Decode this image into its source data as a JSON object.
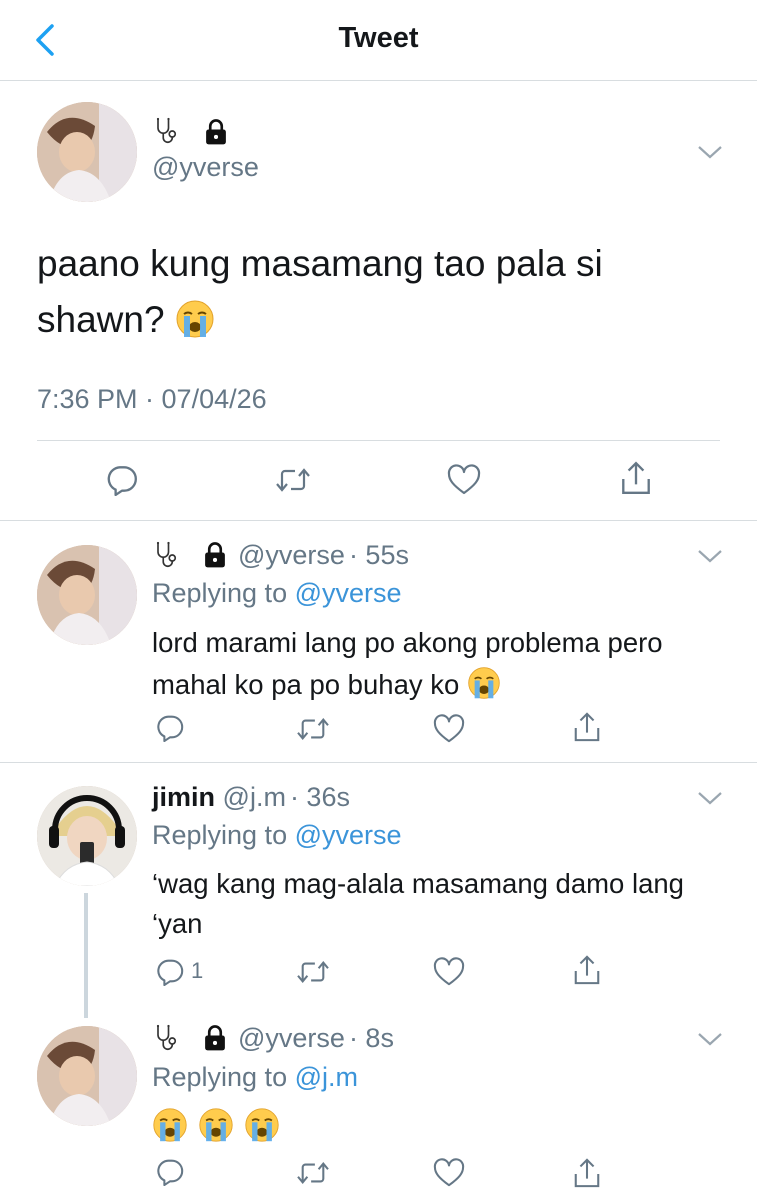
{
  "header": {
    "title": "Tweet",
    "back_icon": "back-chevron-icon"
  },
  "main_tweet": {
    "handle": "@yverse",
    "badges": [
      "stethoscope-icon",
      "lock-icon"
    ],
    "text": "paano kung masamang tao pala si shawn?",
    "emoji": "loudly-crying-face",
    "timestamp": "7:36 PM · 07/04/26"
  },
  "replies": [
    {
      "name": "",
      "handle": "@yverse",
      "time": "· 55s",
      "replying_prefix": "Replying to",
      "replying_to": "@yverse",
      "text": "lord marami lang po akong problema pero mahal ko pa po buhay ko",
      "emoji_count": 1,
      "reply_count": ""
    },
    {
      "name": "jimin",
      "handle": "@j.m",
      "time": "· 36s",
      "replying_prefix": "Replying to",
      "replying_to": "@yverse",
      "text": "‘wag kang mag-alala masamang damo lang ‘yan",
      "emoji_count": 0,
      "reply_count": "1"
    },
    {
      "name": "",
      "handle": "@yverse",
      "time": "· 8s",
      "replying_prefix": "Replying to",
      "replying_to": "@j.m",
      "text": "",
      "emoji_count": 3,
      "reply_count": ""
    }
  ],
  "colors": {
    "accent": "#1da1f2",
    "link": "#3b94d9",
    "muted": "#657786",
    "divider": "#d8dde0"
  }
}
